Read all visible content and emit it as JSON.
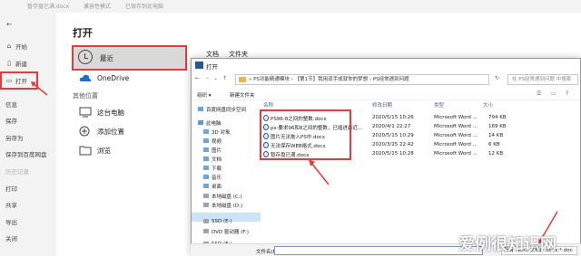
{
  "titlebar": {
    "doc": "暂存盘已满.docx",
    "mode": "兼容性模式",
    "status": "已保存到此电脑"
  },
  "sidebar": {
    "items": [
      {
        "label": "开始",
        "icon": "home-icon"
      },
      {
        "label": "新建",
        "icon": "new-doc-icon"
      },
      {
        "label": "打开",
        "icon": "open-folder-icon"
      },
      {
        "label": "信息"
      },
      {
        "label": "保存"
      },
      {
        "label": "另存为"
      },
      {
        "label": "保存到百度网盘"
      },
      {
        "label": "历史记录"
      },
      {
        "label": "打印"
      },
      {
        "label": "共享"
      },
      {
        "label": "导出"
      },
      {
        "label": "关闭"
      }
    ]
  },
  "backstage": {
    "heading": "打开",
    "recent": "最近",
    "onedrive": "OneDrive",
    "other_locations": "其他位置",
    "this_pc": "这台电脑",
    "add_place": "添加位置",
    "browse": "浏览",
    "tab_docs": "文档",
    "tab_folders": "文件夹"
  },
  "dialog": {
    "title": "打开",
    "address": "« PS功能精通模块 › 【第1节】我用双手成就你的梦想 › PS经常遇到问题",
    "search_placeholder": "在 PS经常遇到问题 中搜索",
    "organize": "组织 ▾",
    "new_folder": "新建文件夹",
    "tree": [
      "百度网盘同步空间",
      "此电脑",
      "3D 对象",
      "视频",
      "图片",
      "文档",
      "下载",
      "音乐",
      "桌面",
      "本地磁盘 (C:)",
      "本地磁盘 (D:)",
      "SSD (E:)",
      "DVD 驱动器 (F:)",
      "SSD (E:)"
    ],
    "columns": [
      "名称",
      "修改日期",
      "类型",
      "大小"
    ],
    "files": [
      {
        "name": "PS96-8之间的整数.docx",
        "date": "2020/5/15 10:26",
        "type": "Microsoft Word ...",
        "size": "794 KB"
      },
      {
        "name": "ps-要求96和8之间的整数，已插进最近...",
        "date": "2020/4/1 22:27",
        "type": "Microsoft Word ...",
        "size": "169 KB"
      },
      {
        "name": "图片无法拖入PS中.docx",
        "date": "2020/5/15 10:29",
        "type": "Microsoft Word ...",
        "size": "14 KB"
      },
      {
        "name": "无法保存WEB格式.docx",
        "date": "2020/3/25 22:42",
        "type": "Microsoft Word ...",
        "size": "6 KB"
      },
      {
        "name": "暂存盘已满.docx",
        "date": "2020/5/15 10:28",
        "type": "Microsoft Word ...",
        "size": "12 KB"
      }
    ],
    "filename_label": "文件名(N):",
    "filter": "所有 Word 文档(*.docx;*.doc"
  },
  "watermark": "爱例很知识网",
  "colors": {
    "highlight": "#e23b3b",
    "word_blue": "#2b579a"
  }
}
